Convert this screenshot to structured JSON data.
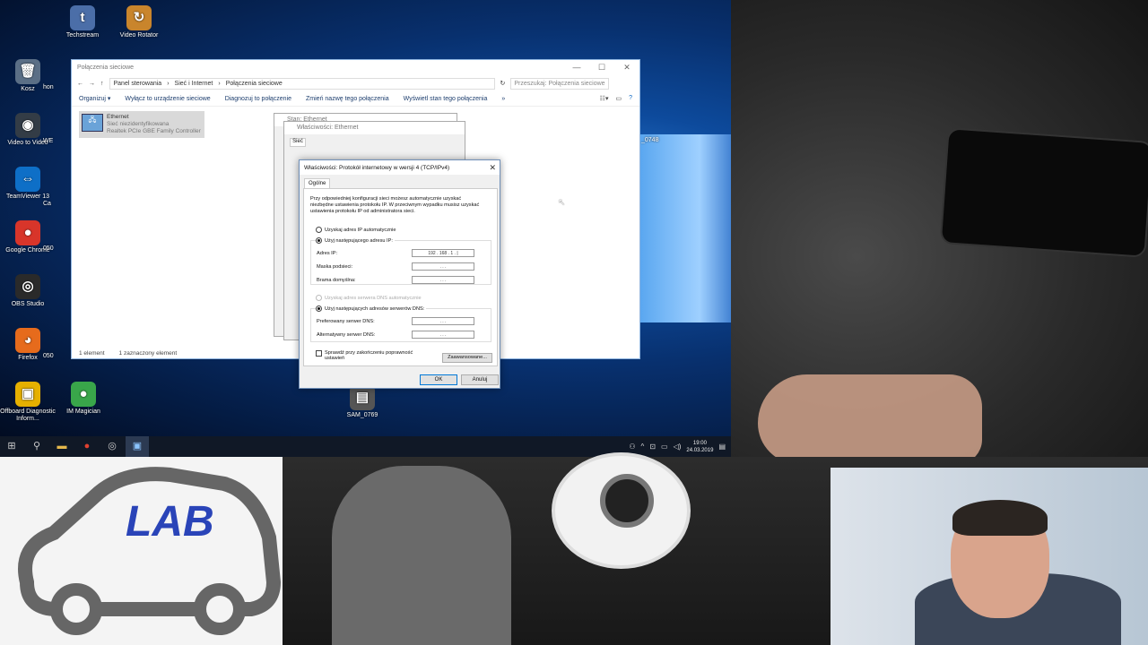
{
  "desktop_icons": [
    {
      "label": "Techstream",
      "glyph": "t",
      "color": "#4b6ea8"
    },
    {
      "label": "Video Rotator",
      "glyph": "↻",
      "color": "#c9852c"
    },
    {
      "label": "Kosz",
      "glyph": "🗑",
      "color": "#5b6f86"
    },
    {
      "label": "Video to Video",
      "glyph": "◉",
      "color": "#333c46"
    },
    {
      "label": "TeamViewer 13",
      "glyph": "⇔",
      "color": "#0e6fc7"
    },
    {
      "label": "Google Chrome",
      "glyph": "●",
      "color": "#d8352a"
    },
    {
      "label": "OBS Studio",
      "glyph": "◎",
      "color": "#2a2a2a"
    },
    {
      "label": "Firefox",
      "glyph": "◕",
      "color": "#e66b1c"
    },
    {
      "label": "Offboard Diagnostic Inform...",
      "glyph": "▣",
      "color": "#e6b000"
    },
    {
      "label": "IM Magician",
      "glyph": "●",
      "color": "#39a64a"
    },
    {
      "label": "SAM_0769",
      "glyph": "▤",
      "color": "#555"
    }
  ],
  "partial_icon_labels": [
    "hon",
    "WE",
    "Ca",
    "050",
    "050",
    "_0748"
  ],
  "explorer": {
    "title": "Połączenia sieciowe",
    "breadcrumb": [
      "Panel sterowania",
      "Sieć i Internet",
      "Połączenia sieciowe"
    ],
    "search_placeholder": "Przeszukaj: Połączenia sieciowe",
    "commands": [
      "Organizuj ▾",
      "Wyłącz to urządzenie sieciowe",
      "Diagnozuj to połączenie",
      "Zmień nazwę tego połączenia",
      "Wyświetl stan tego połączenia",
      "»"
    ],
    "item": {
      "name": "Ethernet",
      "status": "Sieć niezidentyfikowana",
      "adapter": "Realtek PCIe GBE Family Controller"
    },
    "status_left": "1 element",
    "status_right": "1 zaznaczony element"
  },
  "bg_dialog_1": {
    "title": "Stan: Ethernet"
  },
  "bg_dialog_2": {
    "title": "Właściwości: Ethernet",
    "tab": "Sieć"
  },
  "tcp_dialog": {
    "title": "Właściwości: Protokół internetowy w wersji 4 (TCP/IPv4)",
    "tab": "Ogólne",
    "description": "Przy odpowiedniej konfiguracji sieci możesz automatycznie uzyskać niezbędne ustawienia protokołu IP. W przeciwnym wypadku musisz uzyskać ustawienia protokołu IP od administratora sieci.",
    "radio_auto_ip": "Uzyskaj adres IP automatycznie",
    "radio_manual_ip": "Użyj następującego adresu IP:",
    "label_ip": "Adres IP:",
    "ip_value": "192 . 168 . 1 . |",
    "label_mask": "Maska podsieci:",
    "label_gateway": "Brama domyślna:",
    "empty_ip": ". . .",
    "radio_auto_dns": "Uzyskaj adres serwera DNS automatycznie",
    "radio_manual_dns": "Użyj następujących adresów serwerów DNS:",
    "label_dns1": "Preferowany serwer DNS:",
    "label_dns2": "Alternatywny serwer DNS:",
    "validate": "Sprawdź przy zakończeniu poprawność ustawień",
    "advanced": "Zaawansowane...",
    "ok": "OK",
    "cancel": "Anuluj"
  },
  "taskbar": {
    "time": "19:00",
    "date": "24.03.2019"
  },
  "logo_text": "LAB"
}
